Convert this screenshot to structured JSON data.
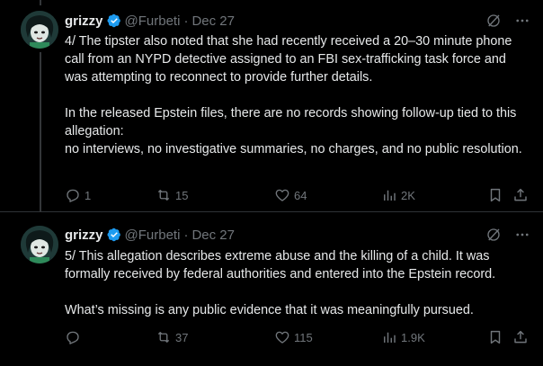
{
  "colors": {
    "background": "#000000",
    "text": "#e7e9ea",
    "muted": "#71767b",
    "verified": "#1d9bf0",
    "divider": "#2f3336"
  },
  "tweets": [
    {
      "author": {
        "name": "grizzy",
        "handle": "@Furbeti",
        "verified": true
      },
      "dot": "·",
      "date": "Dec 27",
      "paragraphs": [
        "4/ The tipster also noted that she had recently received a 20–30 minute phone call from an NYPD detective assigned to an FBI sex-trafficking task force and was attempting to reconnect to provide further details.",
        "In the released Epstein files, there are no records showing follow-up tied to this allegation:",
        "no interviews, no investigative summaries, no charges, and no public resolution."
      ],
      "stats": {
        "replies": "1",
        "reposts": "15",
        "likes": "64",
        "views": "2K"
      },
      "icons": [
        "grok-icon",
        "more-icon",
        "reply-icon",
        "repost-icon",
        "like-icon",
        "views-icon",
        "bookmark-icon",
        "share-icon"
      ]
    },
    {
      "author": {
        "name": "grizzy",
        "handle": "@Furbeti",
        "verified": true
      },
      "dot": "·",
      "date": "Dec 27",
      "paragraphs": [
        "5/ This allegation describes extreme abuse and the killing of a child. It was formally received by federal authorities and entered into the Epstein record.",
        "What’s missing is any public evidence that it was meaningfully pursued."
      ],
      "stats": {
        "replies": "",
        "reposts": "37",
        "likes": "115",
        "views": "1.9K"
      },
      "icons": [
        "grok-icon",
        "more-icon",
        "reply-icon",
        "repost-icon",
        "like-icon",
        "views-icon",
        "bookmark-icon",
        "share-icon"
      ]
    }
  ]
}
